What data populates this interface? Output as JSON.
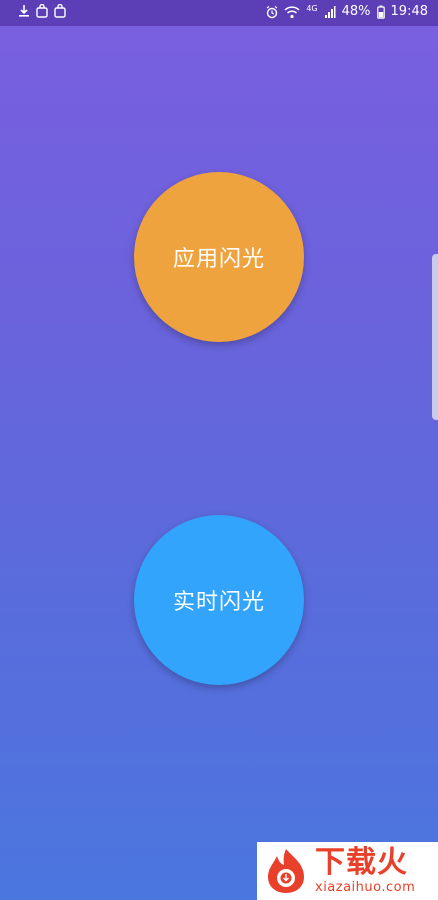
{
  "status_bar": {
    "wifi_label": "4G",
    "battery_percent": "48%",
    "time": "19:48"
  },
  "main": {
    "apply_flash_label": "应用闪光",
    "realtime_flash_label": "实时闪光"
  },
  "watermark": {
    "brand": "下载火",
    "domain": "xiazaihuo.com"
  },
  "colors": {
    "apply_button": "#efa33e",
    "realtime_button": "#32a4fb",
    "status_bar": "#5c3fb7",
    "brand_red": "#e8402a"
  },
  "icons": [
    "download-icon",
    "bag-icon",
    "bag-icon",
    "alarm-icon",
    "wifi-icon",
    "signal-icon",
    "battery-icon",
    "flame-logo-icon"
  ]
}
